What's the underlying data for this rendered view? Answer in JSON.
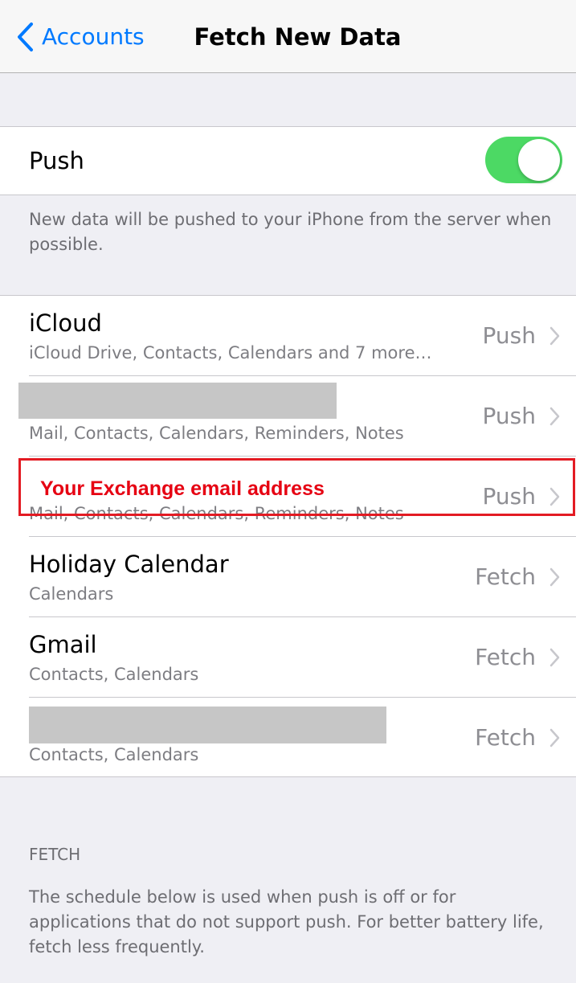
{
  "navbar": {
    "back_label": "Accounts",
    "title": "Fetch New Data"
  },
  "push": {
    "label": "Push",
    "enabled": true,
    "footer": "New data will be pushed to your iPhone from the server when possible."
  },
  "accounts": [
    {
      "title": "iCloud",
      "subtitle": "iCloud Drive, Contacts, Calendars and 7 more…",
      "value": "Push"
    },
    {
      "title": "",
      "subtitle": "Mail, Contacts, Calendars, Reminders, Notes",
      "value": "Push"
    },
    {
      "title": "Your Exchange email address",
      "subtitle": "Mail, Contacts, Calendars, Reminders, Notes",
      "value": "Push"
    },
    {
      "title": "Holiday Calendar",
      "subtitle": "Calendars",
      "value": "Fetch"
    },
    {
      "title": "Gmail",
      "subtitle": "Contacts, Calendars",
      "value": "Fetch"
    },
    {
      "title": "",
      "subtitle": "Contacts, Calendars",
      "value": "Fetch"
    }
  ],
  "fetch": {
    "header": "FETCH",
    "footer": "The schedule below is used when push is off or for applications that do not support push. For better battery life, fetch less frequently."
  },
  "colors": {
    "accent": "#007aff",
    "toggle_on": "#4cd964",
    "highlight": "#e31b23"
  }
}
